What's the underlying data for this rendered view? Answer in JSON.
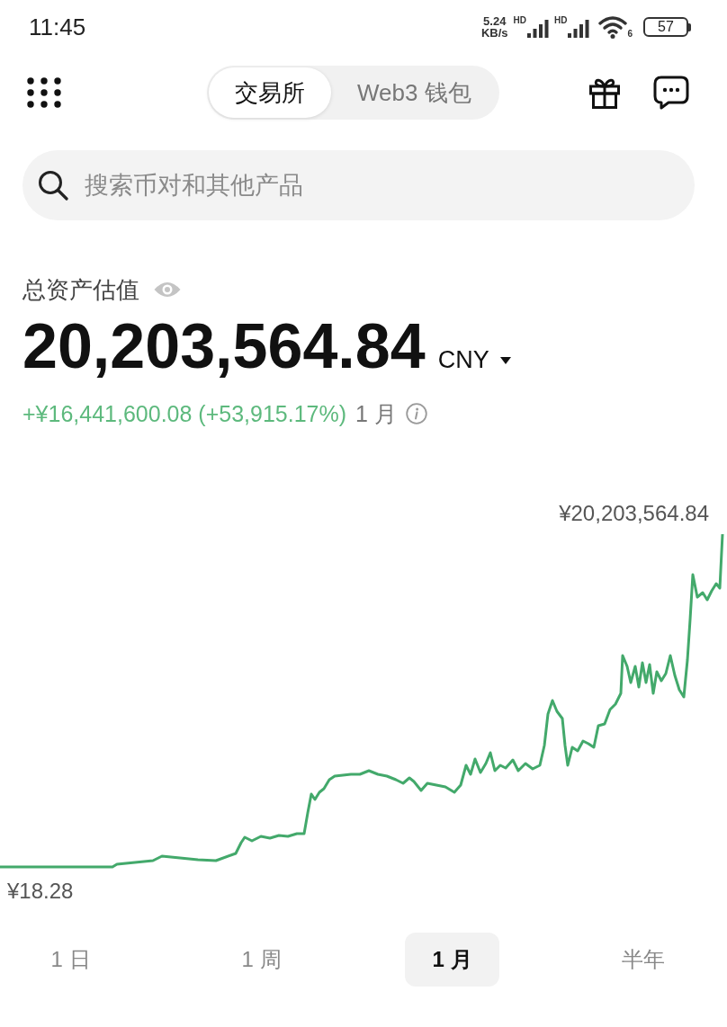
{
  "status_bar": {
    "time": "11:45",
    "net_speed": "5.24",
    "net_speed_unit": "KB/s",
    "signal_labels": [
      "HD",
      "HD"
    ],
    "wifi_label": "6",
    "battery": "57"
  },
  "header": {
    "tabs": [
      {
        "label": "交易所",
        "selected": true
      },
      {
        "label": "Web3 钱包",
        "selected": false
      }
    ]
  },
  "search": {
    "placeholder": "搜索币对和其他产品"
  },
  "balance": {
    "label": "总资产估值",
    "value": "20,203,564.84",
    "currency": "CNY",
    "change": "+¥16,441,600.08 (+53,915.17%)",
    "period": "1 月"
  },
  "chart": {
    "max_label": "¥20,203,564.84",
    "min_label": "¥18.28"
  },
  "periods": [
    {
      "label": "1 日",
      "selected": false
    },
    {
      "label": "1 周",
      "selected": false
    },
    {
      "label": "1 月",
      "selected": true
    },
    {
      "label": "半年",
      "selected": false
    }
  ]
}
